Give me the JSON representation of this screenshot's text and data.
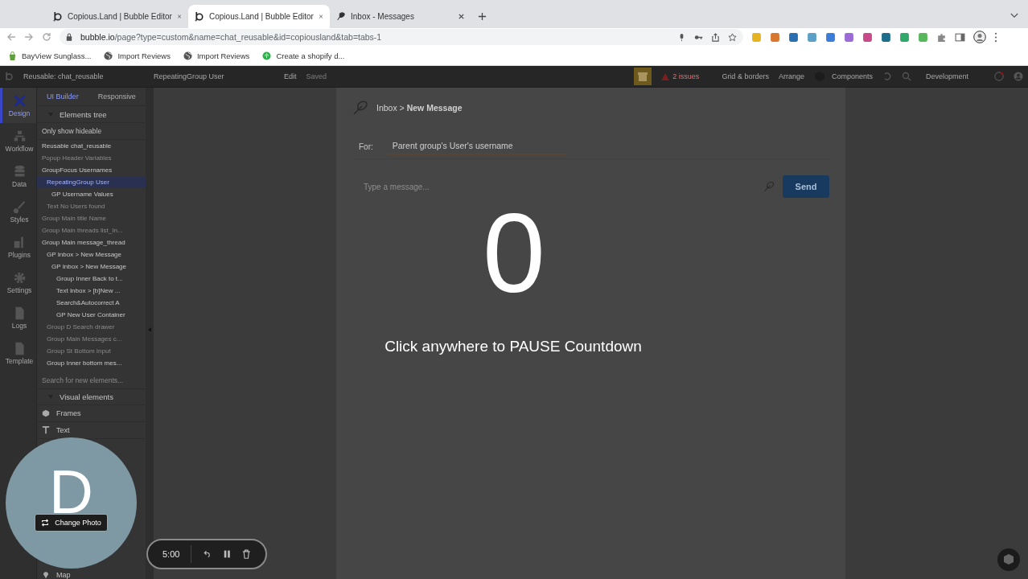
{
  "browser": {
    "tabs": [
      {
        "title": "Copious.Land | Bubble Editor",
        "selected": false,
        "kind": "bubble"
      },
      {
        "title": "Copious.Land | Bubble Editor",
        "selected": true,
        "kind": "bubble"
      },
      {
        "title": "Inbox - Messages",
        "selected": false,
        "kind": "feather"
      }
    ],
    "url_host": "bubble.io",
    "url_path": "/page?type=custom&name=chat_reusable&id=copiousland&tab=tabs-1",
    "bookmarks": [
      {
        "label": "BayView Sunglass...",
        "kind": "shop"
      },
      {
        "label": "Import Reviews",
        "kind": "globe"
      },
      {
        "label": "Import Reviews",
        "kind": "globe"
      },
      {
        "label": "Create a shopify d...",
        "kind": "leaf"
      }
    ]
  },
  "editor": {
    "topbar": {
      "page": "Reusable: chat_reusable",
      "element": "RepeatingGroup User",
      "edit": "Edit",
      "saved": "Saved",
      "issues": "2 issues",
      "grid": "Grid & borders",
      "arrange": "Arrange",
      "components": "Components",
      "environment": "Development"
    },
    "rail": [
      {
        "label": "Design",
        "selected": true,
        "kind": "design"
      },
      {
        "label": "Workflow",
        "selected": false,
        "kind": "workflow"
      },
      {
        "label": "Data",
        "selected": false,
        "kind": "data"
      },
      {
        "label": "Styles",
        "selected": false,
        "kind": "styles"
      },
      {
        "label": "Plugins",
        "selected": false,
        "kind": "plugins"
      },
      {
        "label": "Settings",
        "selected": false,
        "kind": "settings"
      },
      {
        "label": "Logs",
        "selected": false,
        "kind": "logs"
      },
      {
        "label": "Template",
        "selected": false,
        "kind": "template"
      }
    ],
    "panel_tabs": [
      {
        "label": "UI Builder",
        "selected": true
      },
      {
        "label": "Responsive",
        "selected": false
      }
    ],
    "tree_header": "Elements tree",
    "only_hideable": "Only show hideable",
    "tree": [
      {
        "label": "Reusable chat_reusable",
        "faded": false,
        "selected": false
      },
      {
        "label": "Popup Header Variables",
        "faded": true,
        "selected": false
      },
      {
        "label": "GroupFocus Usernames",
        "faded": false,
        "selected": false,
        "children": [
          {
            "label": "RepeatingGroup User",
            "faded": false,
            "selected": true,
            "children": [
              {
                "label": "GP Username Values",
                "faded": false,
                "selected": false
              }
            ]
          },
          {
            "label": "Text No Users found",
            "faded": true,
            "selected": false
          }
        ]
      },
      {
        "label": "Group Main title Name",
        "faded": true,
        "selected": false
      },
      {
        "label": "Group Main threads list_In...",
        "faded": true,
        "selected": false
      },
      {
        "label": "Group Main message_thread",
        "faded": false,
        "selected": false,
        "children": [
          {
            "label": "GP Inbox > New Message",
            "faded": false,
            "selected": false,
            "children": [
              {
                "label": "GP Inbox > New Message",
                "faded": false,
                "selected": false,
                "children": [
                  {
                    "label": "Group Inner Back to t...",
                    "faded": false,
                    "selected": false
                  },
                  {
                    "label": "Text Inbox > [b]New ...",
                    "faded": false,
                    "selected": false
                  },
                  {
                    "label": "Search&Autocorrect A",
                    "faded": false,
                    "selected": false
                  },
                  {
                    "label": "GP New User Container",
                    "faded": false,
                    "selected": false
                  }
                ]
              }
            ]
          },
          {
            "label": "Group D Search drawer",
            "faded": true,
            "selected": false
          },
          {
            "label": "Group Main Messages c...",
            "faded": true,
            "selected": false
          },
          {
            "label": "Group St Bottom Input",
            "faded": true,
            "selected": false
          },
          {
            "label": "Group Inner bottom mes...",
            "faded": false,
            "selected": false
          }
        ]
      }
    ],
    "search_placeholder": "Search for new elements...",
    "visual_header": "Visual elements",
    "visual_items": [
      {
        "label": "Frames",
        "kind": "frames"
      },
      {
        "label": "Text",
        "kind": "text"
      }
    ],
    "map_item": "Map",
    "page": {
      "breadcrumb": "Inbox > **New Message**",
      "for_label": "For:",
      "for_value": "Parent group's User's username",
      "message_placeholder": "Type a message...",
      "send": "Send"
    }
  },
  "countdown": {
    "number": "0",
    "hint": "Click anywhere to PAUSE Countdown"
  },
  "webcam": {
    "initial": "D",
    "change_photo": "Change Photo"
  },
  "recorder": {
    "time": "5:00"
  }
}
